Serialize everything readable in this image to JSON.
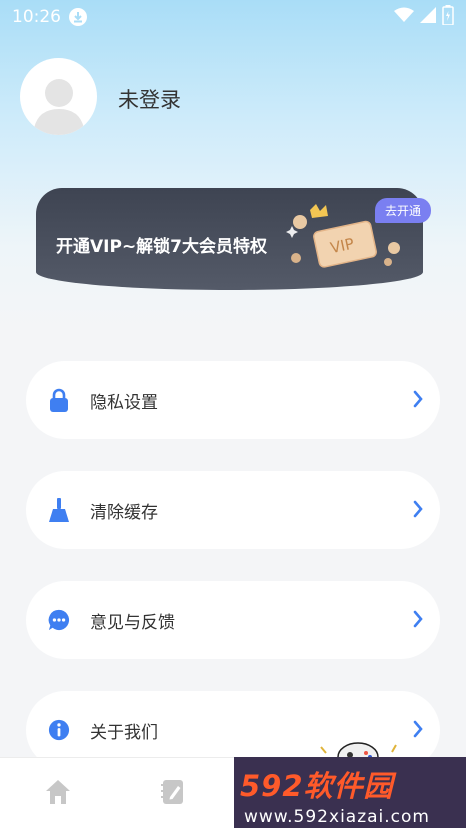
{
  "status_bar": {
    "time": "10:26",
    "icons": [
      "download-icon",
      "wifi-icon",
      "cellular-icon",
      "battery-icon"
    ]
  },
  "profile": {
    "username": "未登录"
  },
  "vip_banner": {
    "text": "开通VIP~解锁7大会员特权",
    "button_label": "去开通",
    "card_label": "VIP"
  },
  "menu": {
    "items": [
      {
        "label": "隐私设置",
        "icon": "lock-icon"
      },
      {
        "label": "清除缓存",
        "icon": "broom-icon"
      },
      {
        "label": "意见与反馈",
        "icon": "chat-bubble-icon"
      },
      {
        "label": "关于我们",
        "icon": "info-icon"
      }
    ]
  },
  "tab_bar": {
    "tabs": [
      {
        "icon": "home-icon"
      },
      {
        "icon": "notes-icon"
      }
    ]
  },
  "watermark": {
    "brand": "592软件园",
    "url": "www.592xiazai.com"
  },
  "colors": {
    "accent": "#3f7ff1",
    "vip_button": "#7a7ff1",
    "banner": "#4a505e",
    "watermark_bg": "#3a3050",
    "watermark_brand": "#ff5a2a"
  }
}
